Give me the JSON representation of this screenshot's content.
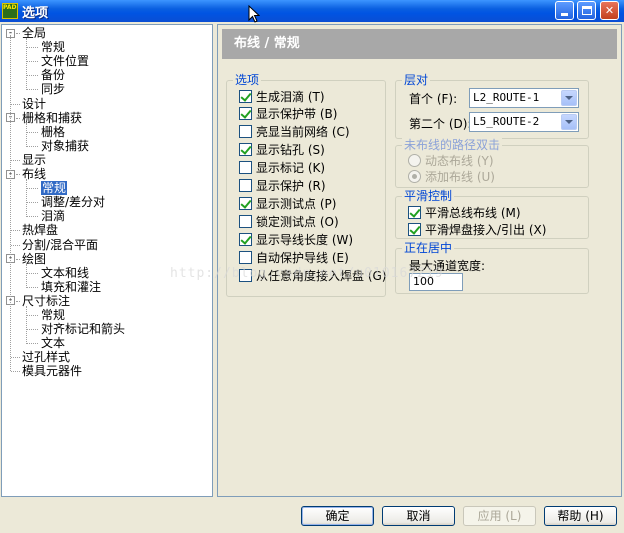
{
  "window": {
    "title": "选项",
    "app_icon_text": "PADS"
  },
  "tree": [
    {
      "label": "全局",
      "level": 0,
      "toggle": "-"
    },
    {
      "label": "常规",
      "level": 1
    },
    {
      "label": "文件位置",
      "level": 1
    },
    {
      "label": "备份",
      "level": 1
    },
    {
      "label": "同步",
      "level": 1
    },
    {
      "label": "设计",
      "level": 0
    },
    {
      "label": "栅格和捕获",
      "level": 0,
      "toggle": "-"
    },
    {
      "label": "栅格",
      "level": 1
    },
    {
      "label": "对象捕获",
      "level": 1
    },
    {
      "label": "显示",
      "level": 0
    },
    {
      "label": "布线",
      "level": 0,
      "toggle": "-"
    },
    {
      "label": "常规",
      "level": 1,
      "selected": true
    },
    {
      "label": "调整/差分对",
      "level": 1
    },
    {
      "label": "泪滴",
      "level": 1
    },
    {
      "label": "热焊盘",
      "level": 0
    },
    {
      "label": "分割/混合平面",
      "level": 0
    },
    {
      "label": "绘图",
      "level": 0,
      "toggle": "-"
    },
    {
      "label": "文本和线",
      "level": 1
    },
    {
      "label": "填充和灌注",
      "level": 1
    },
    {
      "label": "尺寸标注",
      "level": 0,
      "toggle": "-"
    },
    {
      "label": "常规",
      "level": 1
    },
    {
      "label": "对齐标记和箭头",
      "level": 1
    },
    {
      "label": "文本",
      "level": 1
    },
    {
      "label": "过孔样式",
      "level": 0
    },
    {
      "label": "模具元器件",
      "level": 0
    }
  ],
  "page": {
    "title": "布线 / 常规"
  },
  "options_group": {
    "title": "选项",
    "items": [
      {
        "label": "生成泪滴 (T)",
        "checked": true
      },
      {
        "label": "显示保护带 (B)",
        "checked": true
      },
      {
        "label": "亮显当前网络 (C)",
        "checked": false
      },
      {
        "label": "显示钻孔 (S)",
        "checked": true
      },
      {
        "label": "显示标记 (K)",
        "checked": false
      },
      {
        "label": "显示保护 (R)",
        "checked": false
      },
      {
        "label": "显示测试点 (P)",
        "checked": true
      },
      {
        "label": "锁定测试点 (O)",
        "checked": false
      },
      {
        "label": "显示导线长度 (W)",
        "checked": true
      },
      {
        "label": "自动保护导线 (E)",
        "checked": false
      },
      {
        "label": "从任意角度接入焊盘 (G)",
        "checked": false
      }
    ]
  },
  "layers_group": {
    "title": "层对",
    "first_label": "首个 (F):",
    "first_value": "L2_ROUTE-1",
    "second_label": "第二个 (D):",
    "second_value": "L5_ROUTE-2"
  },
  "unrouted_group": {
    "title": "未布线的路径双击",
    "options": [
      {
        "label": "动态布线 (Y)",
        "selected": false
      },
      {
        "label": "添加布线 (U)",
        "selected": true
      }
    ]
  },
  "smooth_group": {
    "title": "平滑控制",
    "items": [
      {
        "label": "平滑总线布线 (M)",
        "checked": true
      },
      {
        "label": "平滑焊盘接入/引出 (X)",
        "checked": true
      }
    ]
  },
  "center_group": {
    "title": "正在居中",
    "max_width_label": "最大通道宽度:",
    "max_width_value": "100"
  },
  "buttons": {
    "ok": "确定",
    "cancel": "取消",
    "apply": "应用 (L)",
    "help": "帮助 (H)"
  },
  "watermark": "http://blog.csdn.net/u010167219"
}
